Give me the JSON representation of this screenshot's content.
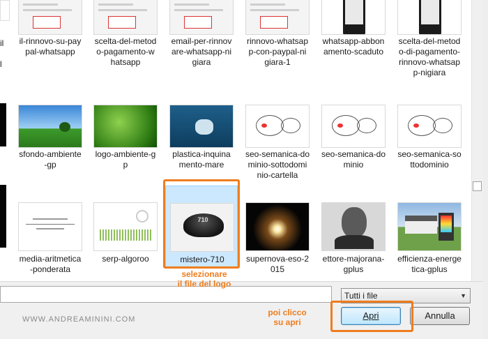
{
  "files": [
    {
      "name": "il-rinnovo-su-pay\npal-whatsapp",
      "thumb": "screenshot"
    },
    {
      "name": "scelta-del-metod\no-pagamento-w\nhatsapp",
      "thumb": "screenshot"
    },
    {
      "name": "email-per-rinnov\nare-whatsapp-ni\ngiara",
      "thumb": "screenshot"
    },
    {
      "name": "rinnovo-whatsap\np-con-paypal-ni\ngiara-1",
      "thumb": "screenshot"
    },
    {
      "name": "whatsapp-abbon\namento-scaduto",
      "thumb": "phone"
    },
    {
      "name": "scelta-del-metod\no-di-pagamento-\nrinnovo-whatsap\np-nigiara",
      "thumb": "phone"
    },
    {
      "name": "sfondo-ambiente\n-gp",
      "thumb": "landscape"
    },
    {
      "name": "logo-ambiente-g\np",
      "thumb": "leaves"
    },
    {
      "name": "plastica-inquina\nmento-mare",
      "thumb": "sea"
    },
    {
      "name": "seo-semanica-do\nminio-sottodomi\nnio-cartella",
      "thumb": "diagram"
    },
    {
      "name": "seo-semanica-do\nminio",
      "thumb": "diagram"
    },
    {
      "name": "seo-semanica-so\nttodominio",
      "thumb": "diagram"
    },
    {
      "name": "media-aritmetica\n-ponderata",
      "thumb": "formula"
    },
    {
      "name": "serp-algoroo",
      "thumb": "chart"
    },
    {
      "name": "mistero-710",
      "thumb": "cap",
      "selected": true
    },
    {
      "name": "supernova-eso-2\n015",
      "thumb": "space"
    },
    {
      "name": "ettore-majorana-\ngplus",
      "thumb": "portrait"
    },
    {
      "name": "efficienza-energe\ntica-gplus",
      "thumb": "house"
    }
  ],
  "left_partial": [
    "il",
    "l"
  ],
  "cap_label": "710",
  "filename_value": "",
  "filter_value": "Tutti i file",
  "open_label": "Apri",
  "cancel_label": "Annulla",
  "watermark": "WWW.ANDREAMININI.COM",
  "annotation_select": "selezionare\nil file del logo",
  "annotation_open": "poi clicco\nsu apri",
  "accent_color": "#ee7d1e"
}
